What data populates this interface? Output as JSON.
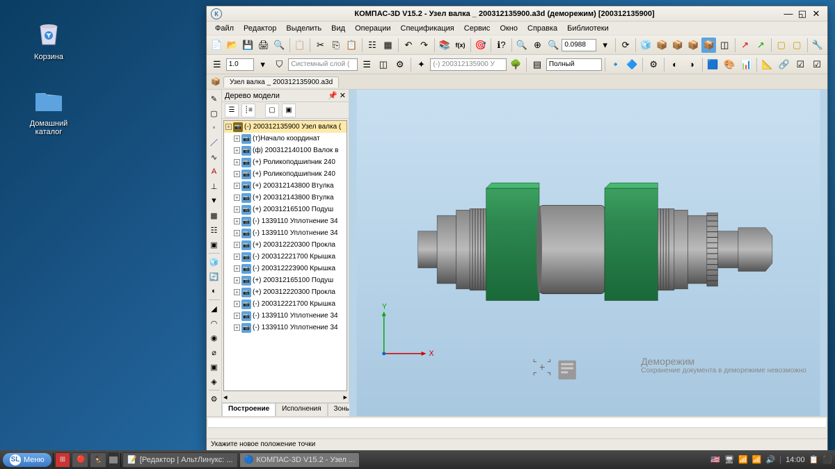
{
  "desktop": {
    "trash": "Корзина",
    "home": "Домашний каталог"
  },
  "window": {
    "title": "КОМПАС-3D V15.2  - Узел валка _ 200312135900.a3d (деморежим) [200312135900]",
    "tab": "Узел валка _ 200312135900.a3d"
  },
  "menu": [
    "Файл",
    "Редактор",
    "Выделить",
    "Вид",
    "Операции",
    "Спецификация",
    "Сервис",
    "Окно",
    "Справка",
    "Библиотеки"
  ],
  "toolbar2": {
    "scale": "1.0",
    "layer": "Системный слой (",
    "doc": "(-) 200312135900 У",
    "mode": "Полный",
    "zoom": "0.0988"
  },
  "tree": {
    "header": "Дерево модели",
    "items": [
      {
        "t": "(-) 200312135900 Узел валка (",
        "root": true,
        "folder": true
      },
      {
        "t": "(т)Начало координат",
        "lvl": 1
      },
      {
        "t": "(ф) 200312140100 Валок в",
        "lvl": 1
      },
      {
        "t": "(+) Роликоподшипник 240",
        "lvl": 1
      },
      {
        "t": "(+) Роликоподшипник 240",
        "lvl": 1
      },
      {
        "t": "(+) 200312143800 Втулка",
        "lvl": 1
      },
      {
        "t": "(+) 200312143800 Втулка",
        "lvl": 1
      },
      {
        "t": "(+) 200312165100 Подуш",
        "lvl": 1
      },
      {
        "t": "(-) 1339110 Уплотнение 34",
        "lvl": 1
      },
      {
        "t": "(-) 1339110 Уплотнение 34",
        "lvl": 1
      },
      {
        "t": "(+) 200312220300 Прокла",
        "lvl": 1
      },
      {
        "t": "(-) 200312221700 Крышка",
        "lvl": 1
      },
      {
        "t": "(-) 200312223900 Крышка",
        "lvl": 1
      },
      {
        "t": "(+) 200312165100 Подуш",
        "lvl": 1
      },
      {
        "t": "(+) 200312220300 Прокла",
        "lvl": 1
      },
      {
        "t": "(-) 200312221700 Крышка",
        "lvl": 1
      },
      {
        "t": "(-) 1339110 Уплотнение 34",
        "lvl": 1
      },
      {
        "t": "(-) 1339110 Уплотнение 34",
        "lvl": 1
      }
    ],
    "tabs": [
      "Построение",
      "Исполнения",
      "Зоны"
    ]
  },
  "demo": {
    "title": "Деморежим",
    "sub": "Сохранение документа в деморежиме невозможно"
  },
  "status": "Укажите новое положение точки",
  "taskbar": {
    "start": "Меню",
    "tasks": [
      {
        "label": "[Редактор | АльтЛинукс: ...",
        "ic": "📝"
      },
      {
        "label": "КОМПАС-3D V15.2  - Узел ...",
        "ic": "🔵",
        "active": true
      }
    ],
    "time": "14:00"
  },
  "axes": {
    "x": "X",
    "y": "Y"
  }
}
